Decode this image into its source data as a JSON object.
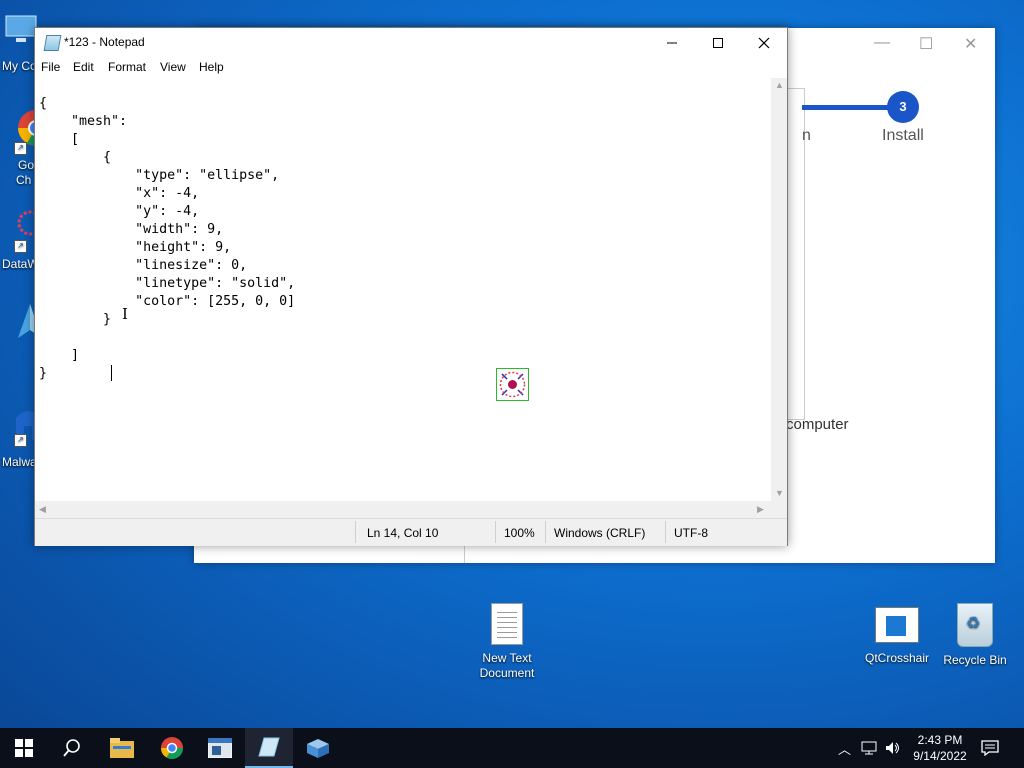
{
  "desktop": {
    "left_icons": [
      {
        "label": "My Co",
        "icon": "this-pc-icon"
      },
      {
        "label": "Go",
        "label2": "Ch",
        "icon": "chrome-icon"
      },
      {
        "label": "DataW",
        "icon": "datawrapper-icon"
      },
      {
        "label": "",
        "icon": "app-icon"
      },
      {
        "label": "Malwa",
        "icon": "malwarebytes-icon"
      }
    ],
    "icons": [
      {
        "label": "New Text Document",
        "icon": "text-document-icon"
      },
      {
        "label": "QtCrosshair",
        "icon": "qtcrosshair-icon"
      },
      {
        "label": "Recycle Bin",
        "icon": "recycle-bin-icon"
      }
    ]
  },
  "installer": {
    "step_number": "3",
    "step_label": "Install",
    "partial_step_label": "n",
    "body_text": "computer",
    "accent": "#1a56c8"
  },
  "notepad": {
    "title": "*123 - Notepad",
    "menu": [
      "File",
      "Edit",
      "Format",
      "View",
      "Help"
    ],
    "content": "{\n    \"mesh\":\n    [\n        {\n            \"type\": \"ellipse\",\n            \"x\": -4,\n            \"y\": -4,\n            \"width\": 9,\n            \"height\": 9,\n            \"linesize\": 0,\n            \"linetype\": \"solid\",\n            \"color\": [255, 0, 0]\n        }\n\n    ]\n}",
    "status": {
      "position": "Ln 14, Col 10",
      "zoom": "100%",
      "line_ending": "Windows (CRLF)",
      "encoding": "UTF-8"
    },
    "window_controls": [
      "minimize-icon",
      "maximize-icon",
      "close-icon"
    ]
  },
  "crosshair": {
    "frame_color": "#2fb82f",
    "center_color": "#b01050",
    "marker_color": "#1f2fd0"
  },
  "taskbar": {
    "items": [
      "start-icon",
      "search-icon",
      "file-explorer-icon",
      "chrome-icon",
      "app-window-icon",
      "notepad-icon",
      "package-icon"
    ],
    "time": "2:43 PM",
    "date": "9/14/2022"
  }
}
